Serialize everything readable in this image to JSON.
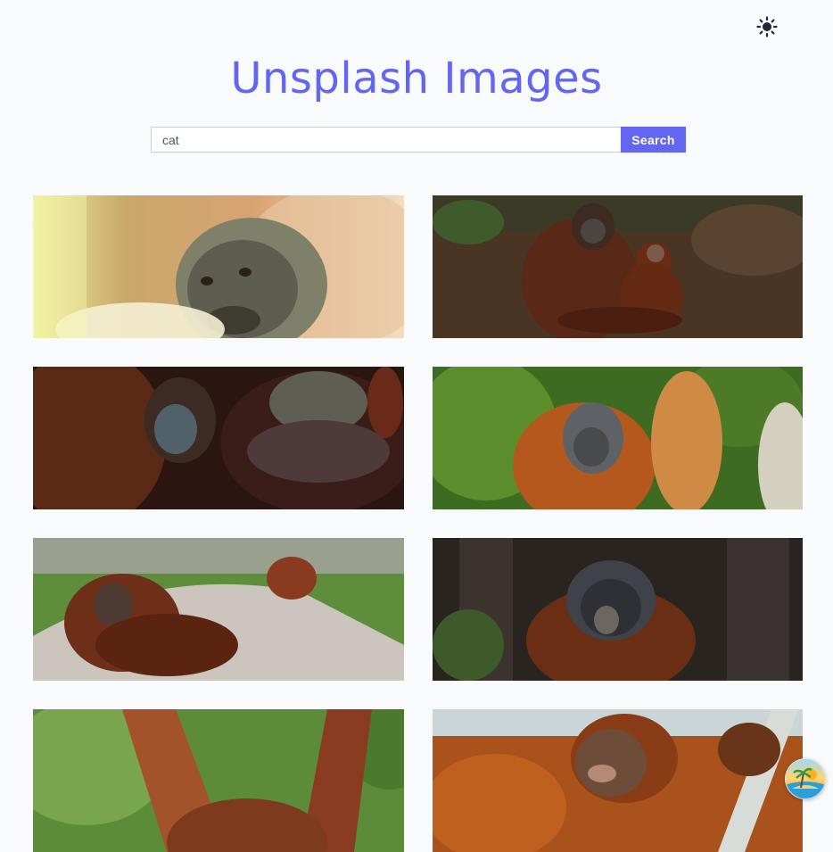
{
  "header": {
    "title": "Unsplash Images",
    "theme_toggle_icon": "sun-icon"
  },
  "search": {
    "value": "cat",
    "placeholder": "",
    "button_label": "Search"
  },
  "colors": {
    "accent": "#6366f1",
    "background": "#f8fafc"
  },
  "gallery": {
    "images": [
      {
        "subject": "orangutan-face-closeup"
      },
      {
        "subject": "orangutan-mother-and-baby"
      },
      {
        "subject": "orangutan-mother-and-baby-closeup"
      },
      {
        "subject": "orangutan-scratching-head"
      },
      {
        "subject": "orangutan-resting-on-rock"
      },
      {
        "subject": "orangutan-flanged-male"
      },
      {
        "subject": "orangutan-arms-raised"
      },
      {
        "subject": "orangutan-holding-rope"
      }
    ]
  },
  "floating_button": {
    "icon": "island-sunset-icon"
  }
}
